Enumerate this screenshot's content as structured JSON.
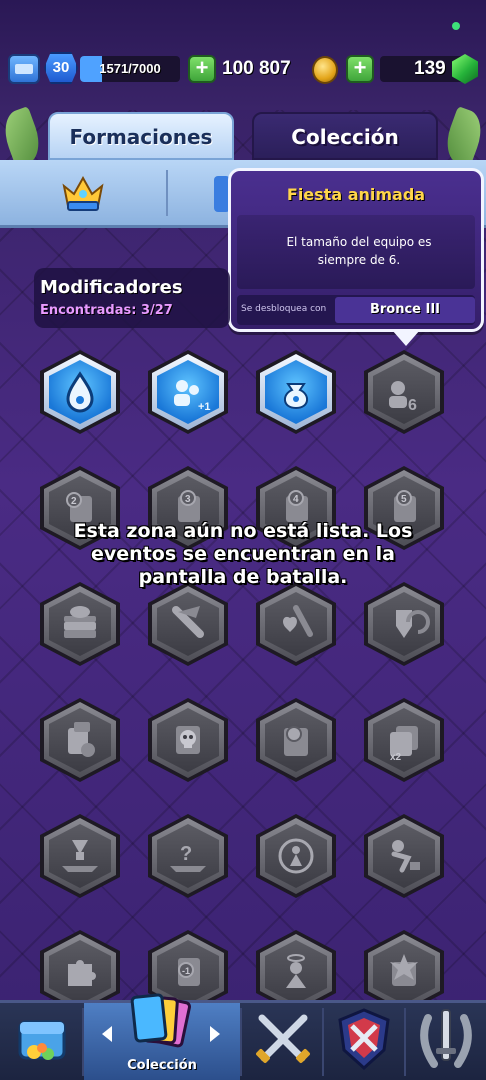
{
  "topbar": {
    "level": "30",
    "xp": "1571/7000",
    "xp_progress": 0.224,
    "gold": "100 807",
    "gems": "139",
    "icons": {
      "level": "crown-level-icon",
      "gold_add": "plus-icon",
      "gold": "gold-coin-icon",
      "gems_add": "plus-icon",
      "gems": "gem-icon"
    }
  },
  "tabs": [
    {
      "label": "Formaciones",
      "active": true
    },
    {
      "label": "Colección",
      "active": false
    }
  ],
  "subtabs": [
    {
      "icon": "crown-icon",
      "active": true
    },
    {
      "icon": "card-icon",
      "active": false
    }
  ],
  "tooltip": {
    "title": "Fiesta animada",
    "description_line1": "El tamaño del equipo es",
    "description_line2": "siempre de  6.",
    "unlock_label": "Se desbloquea con",
    "rank": "Bronce III"
  },
  "modifiers": {
    "title": "Modificadores",
    "found": "Encontradas: 3/27"
  },
  "modifier_grid": [
    {
      "icon": "elixir-drop-icon",
      "unlocked": true
    },
    {
      "icon": "team-plus-one-icon",
      "unlocked": true
    },
    {
      "icon": "money-bag-icon",
      "unlocked": true
    },
    {
      "icon": "team-six-icon",
      "unlocked": false
    },
    {
      "icon": "card-two-icon",
      "unlocked": false
    },
    {
      "icon": "card-three-icon",
      "unlocked": false
    },
    {
      "icon": "card-four-icon",
      "unlocked": false
    },
    {
      "icon": "card-five-icon",
      "unlocked": false
    },
    {
      "icon": "stacked-cards-icon",
      "unlocked": false
    },
    {
      "icon": "sword-wing-icon",
      "unlocked": false
    },
    {
      "icon": "heart-sword-icon",
      "unlocked": false
    },
    {
      "icon": "shield-return-icon",
      "unlocked": false
    },
    {
      "icon": "card-gear-icon",
      "unlocked": false
    },
    {
      "icon": "skull-card-icon",
      "unlocked": false
    },
    {
      "icon": "coin-card-icon",
      "unlocked": false
    },
    {
      "icon": "double-card-icon",
      "unlocked": false
    },
    {
      "icon": "down-arrow-platform-icon",
      "unlocked": false
    },
    {
      "icon": "question-platform-icon",
      "unlocked": false
    },
    {
      "icon": "target-figure-icon",
      "unlocked": false
    },
    {
      "icon": "king-kick-icon",
      "unlocked": false
    },
    {
      "icon": "puzzle-piece-icon",
      "unlocked": false
    },
    {
      "icon": "card-minus-one-icon",
      "unlocked": false
    },
    {
      "icon": "angel-figure-icon",
      "unlocked": false
    },
    {
      "icon": "explosion-card-icon",
      "unlocked": false
    }
  ],
  "banner": {
    "line1": "Esta zona aún no está lista. Los",
    "line2": "eventos se encuentran en la",
    "line3": "pantalla de batalla."
  },
  "navbar": {
    "items": [
      {
        "icon": "chest-shop-icon",
        "label": ""
      },
      {
        "icon": "cards-collection-icon",
        "label": "Colección",
        "active": true
      },
      {
        "icon": "crossed-swords-icon",
        "label": ""
      },
      {
        "icon": "clan-shield-icon",
        "label": ""
      },
      {
        "icon": "laurel-sword-icon",
        "label": ""
      }
    ]
  },
  "colors": {
    "accent_blue": "#1a78d8",
    "tooltip_title": "#ffd54a",
    "found_text": "#e99bff",
    "gem_green": "#26b33a",
    "plus_green": "#3fa53a"
  }
}
